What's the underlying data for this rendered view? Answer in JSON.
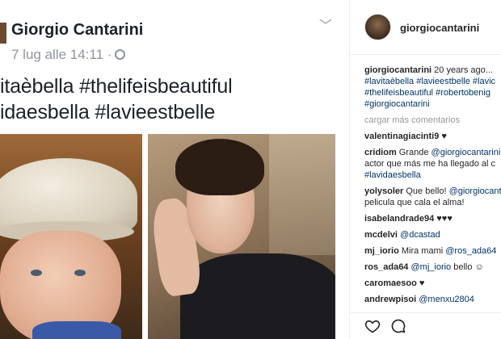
{
  "post_image": {
    "fb_name": "Giorgio Cantarini",
    "fb_time": "7 lug alle 14:11 ·",
    "fb_text_line1": "itaèbella #thelifeisbeautiful",
    "fb_text_line2": "idaesbella #lavieestbelle"
  },
  "instagram": {
    "username": "giorgiocantarini",
    "caption": {
      "user": "giorgiocantarini",
      "text": " 20 years ago...",
      "line2": "#lavitaèbella #lavieestbelle #lavic",
      "line3": "#thelifeisbeautiful #robertobenig",
      "line4": "#giorgiocantarini"
    },
    "load_more": "cargar más comentarios",
    "comments": [
      {
        "user": "valentinagiacinti9",
        "text": " ♥"
      },
      {
        "user": "cridiom",
        "text": " Grande ",
        "mention": "@giorgiocantarini",
        "line2": "actor que más me ha llegado al c",
        "line3": "#lavidaesbella"
      },
      {
        "user": "yolysoler",
        "text": " Que bello! ",
        "mention": "@giorgiocanta",
        "line2": "pelicula que cala el alma!"
      },
      {
        "user": "isabelandrade94",
        "text": " ♥♥♥"
      },
      {
        "user": "mcdelvi",
        "text": " ",
        "mention": "@dcastad"
      },
      {
        "user": "mj_iorio",
        "text": " Mira mami ",
        "mention": "@ros_ada64"
      },
      {
        "user": "ros_ada64",
        "text": " ",
        "mention": "@mj_iorio",
        "suffix": " bello ☺"
      },
      {
        "user": "caromaesoo",
        "text": " ♥"
      },
      {
        "user": "andrewpisoi",
        "text": " ",
        "mention": "@menxu2804"
      }
    ]
  },
  "icons": {
    "like": "heart-icon",
    "comment": "comment-icon",
    "options": "chevron-down-icon",
    "privacy": "globe-icon"
  }
}
